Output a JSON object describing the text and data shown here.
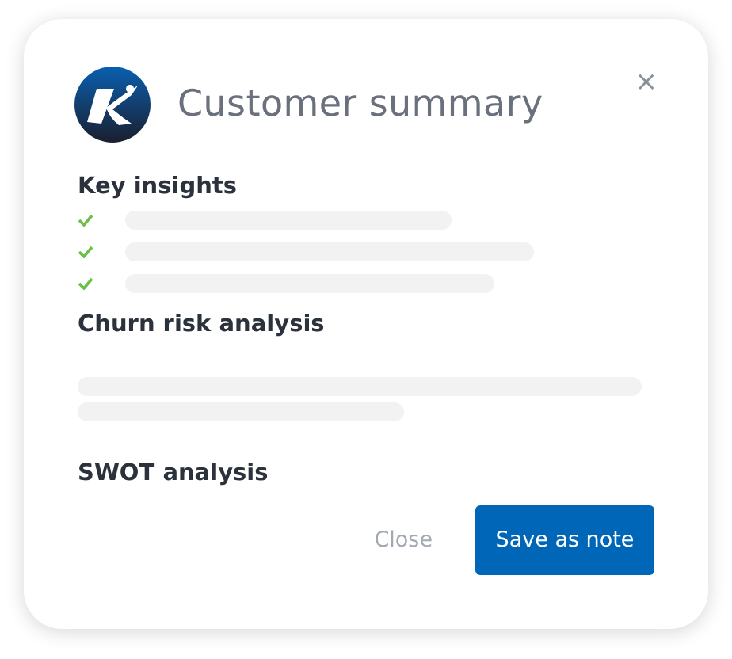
{
  "dialog": {
    "title": "Customer summary",
    "close_icon": "×"
  },
  "sections": [
    {
      "heading": "Key insights",
      "kind": "checklist"
    },
    {
      "heading": "Churn risk analysis",
      "kind": "paragraph"
    },
    {
      "heading": "SWOT analysis",
      "kind": "empty"
    }
  ],
  "buttons": [
    {
      "label": "Close",
      "kind": "text"
    },
    {
      "label": "Save as note",
      "kind": "primary"
    }
  ]
}
